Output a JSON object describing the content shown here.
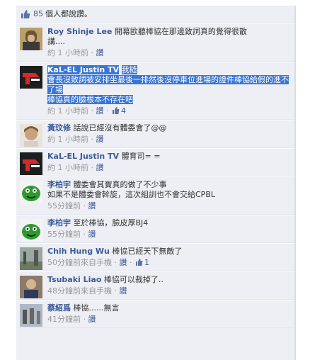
{
  "likes": {
    "count": "85",
    "text": "個人都說讚。"
  },
  "comments": [
    {
      "name": "Roy Shinje Lee",
      "text": "開幕歐聽棒協在那邊致詞真的覺得很散\n講....",
      "time": "約 1 小時前",
      "sep": " · ",
      "like": "讚",
      "likes": ""
    },
    {
      "name": "KaL-EL Justin TV",
      "text": "我糙\n會長沒致詞被安排坐最後一排然後沒停車位進場的證件棒協給假的進不了場\n棒協真的臉根本不存在吧",
      "time": "約 1 小時前",
      "sep": " · ",
      "like": "讚",
      "likes": "4"
    },
    {
      "name": "黃玟修",
      "text": "話說已經沒有體委會了@@",
      "time": "約 1 小時前",
      "sep": " · ",
      "like": "讚",
      "likes": ""
    },
    {
      "name": "KaL-EL Justin TV",
      "text": "體育司= =",
      "time": "約 1 小時前",
      "sep": " · ",
      "like": "讚",
      "likes": ""
    },
    {
      "name": "李柏宇",
      "text": "體委會其實真的做了不少事\n如果不是體委會斡旋，這次組訓也不會交給CPBL",
      "time": "55分鐘前",
      "sep": " · ",
      "like": "讚",
      "likes": ""
    },
    {
      "name": "李柏宇",
      "text": "至於棒協，臉皮厚BJ4",
      "time": "55分鐘前",
      "sep": " · ",
      "like": "讚",
      "likes": ""
    },
    {
      "name": "Chih Hung Wu",
      "text": "棒協已經天下無敵了",
      "time": "50分鐘前來自手機",
      "sep": " · ",
      "like": "讚",
      "likes": "1"
    },
    {
      "name": "Tsubaki Liao",
      "text": "棒協可以裁掉了..",
      "time": "48分鐘前來自手機",
      "sep": " · ",
      "like": "讚",
      "likes": ""
    },
    {
      "name": "蔡紹爲",
      "text": "棒協......無言",
      "time": "41分鐘前",
      "sep": " · ",
      "like": "讚",
      "likes": ""
    }
  ]
}
